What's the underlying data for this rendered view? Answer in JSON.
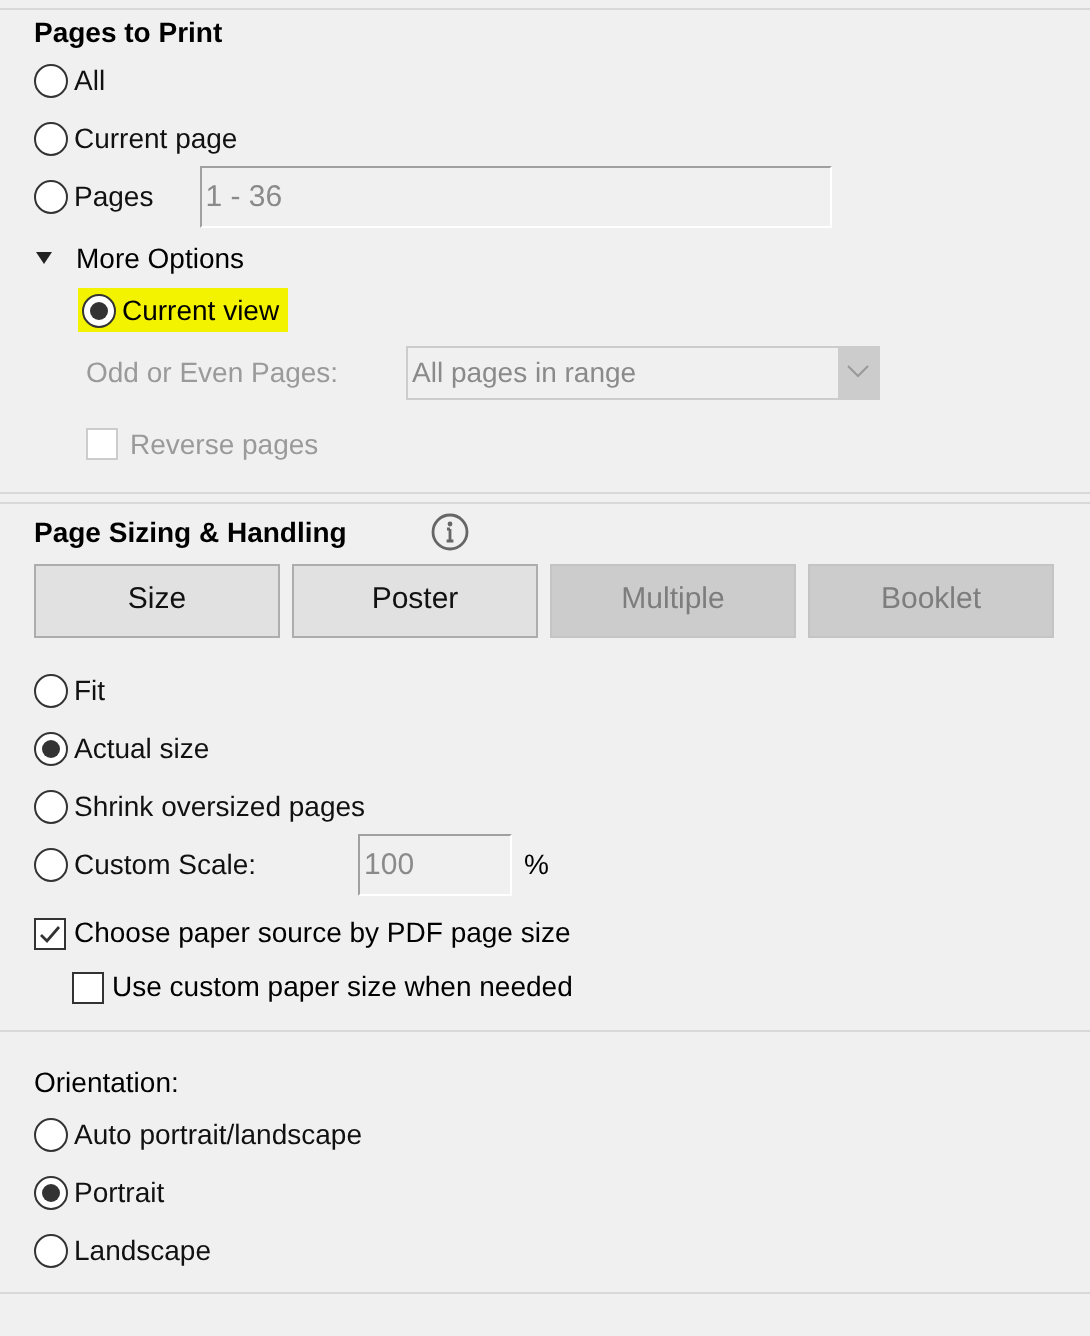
{
  "pages_to_print": {
    "title": "Pages to Print",
    "options": [
      {
        "label": "All",
        "selected": false
      },
      {
        "label": "Current page",
        "selected": false
      },
      {
        "label": "Pages",
        "selected": false,
        "field": {
          "value": "1 - 36",
          "disabled": true
        }
      }
    ],
    "more_options": {
      "label": "More Options",
      "expanded": true,
      "current_view": {
        "label": "Current view",
        "selected": true,
        "highlighted": true
      },
      "odd_even": {
        "label": "Odd or Even Pages:",
        "value": "All pages in range",
        "disabled": true
      },
      "reverse": {
        "label": "Reverse pages",
        "checked": false,
        "disabled": true
      }
    }
  },
  "page_sizing": {
    "title": "Page Sizing & Handling",
    "buttons": [
      {
        "label": "Size",
        "disabled": false
      },
      {
        "label": "Poster",
        "disabled": false
      },
      {
        "label": "Multiple",
        "disabled": true
      },
      {
        "label": "Booklet",
        "disabled": true
      }
    ],
    "options": [
      {
        "label": "Fit",
        "selected": false
      },
      {
        "label": "Actual size",
        "selected": true
      },
      {
        "label": "Shrink oversized pages",
        "selected": false
      },
      {
        "label": "Custom Scale:",
        "selected": false,
        "field": {
          "value": "100",
          "disabled": true
        },
        "unit": "%"
      }
    ],
    "checkboxes": [
      {
        "label": "Choose paper source by PDF page size",
        "checked": true,
        "indented": false
      },
      {
        "label": "Use custom paper size when needed",
        "checked": false,
        "indented": true
      }
    ]
  },
  "orientation": {
    "title": "Orientation:",
    "options": [
      {
        "label": "Auto portrait/landscape",
        "selected": false
      },
      {
        "label": "Portrait",
        "selected": true
      },
      {
        "label": "Landscape",
        "selected": false
      }
    ]
  }
}
